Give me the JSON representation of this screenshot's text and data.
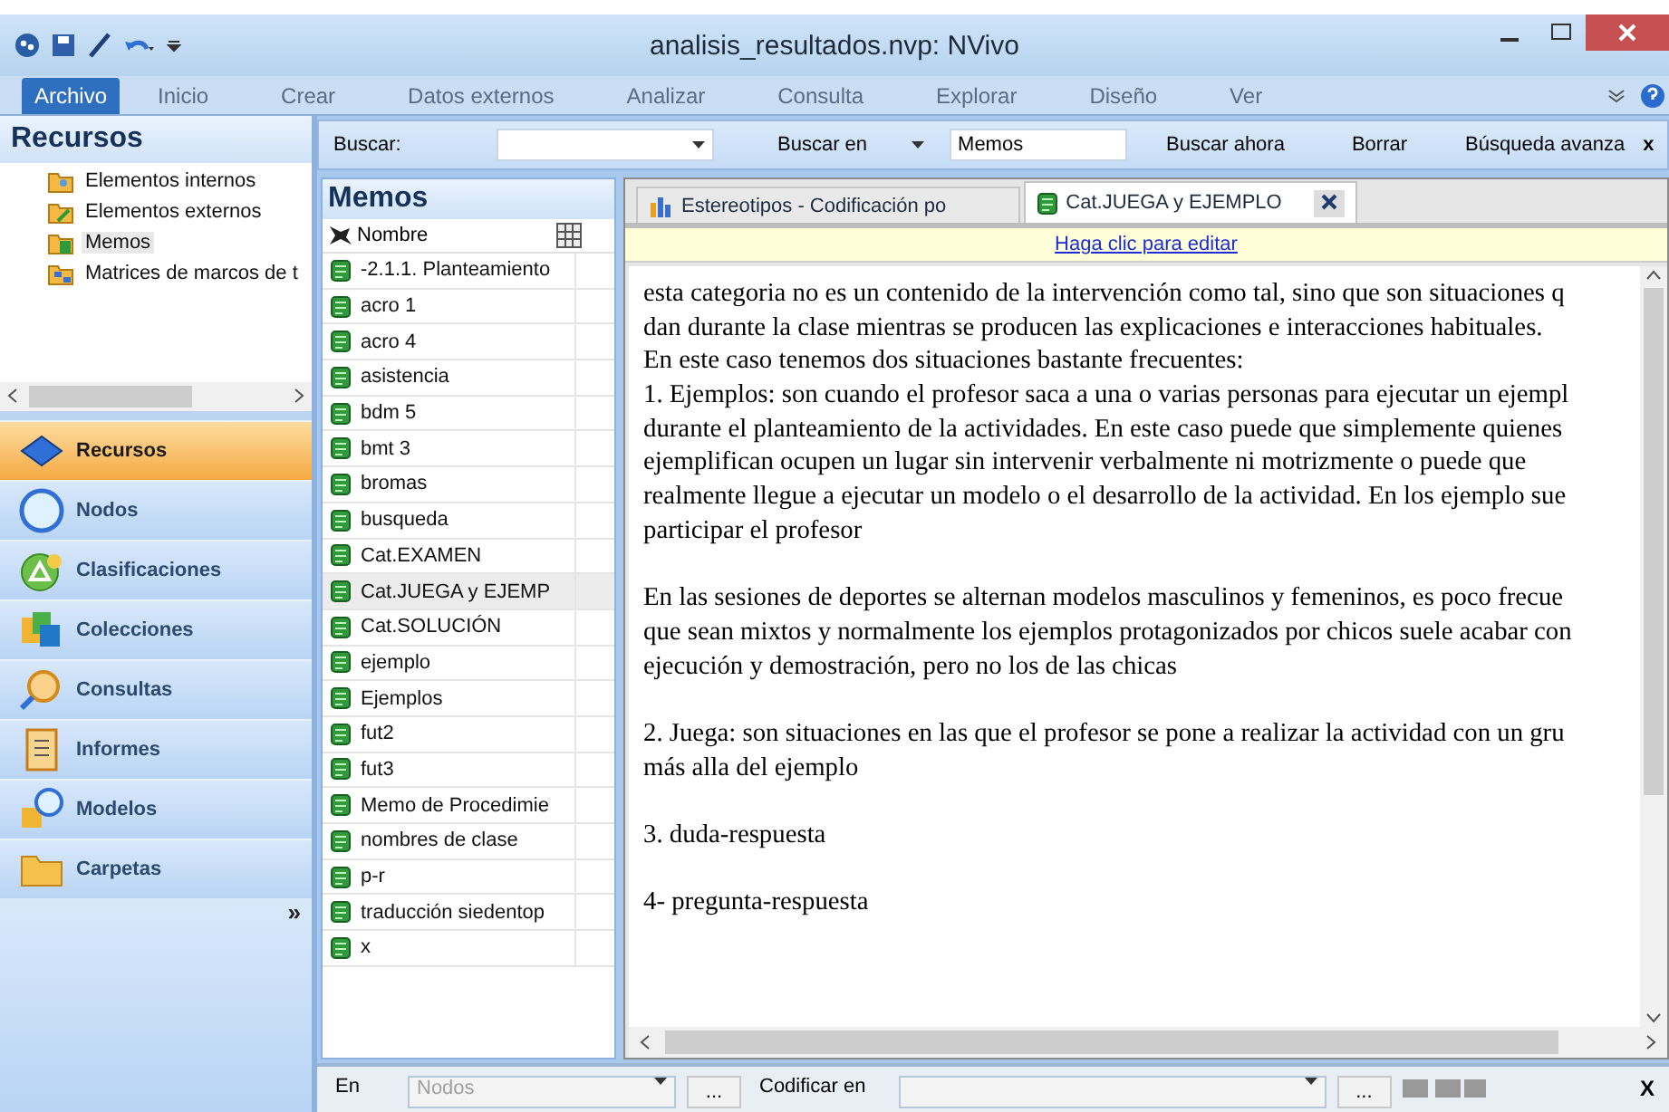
{
  "window": {
    "title": "analisis_resultados.nvp: NVivo"
  },
  "ribbon_tabs": [
    {
      "label": "Archivo",
      "selected": true
    },
    {
      "label": "Inicio",
      "selected": false
    },
    {
      "label": "Crear",
      "selected": false
    },
    {
      "label": "Datos externos",
      "selected": false
    },
    {
      "label": "Analizar",
      "selected": false
    },
    {
      "label": "Consulta",
      "selected": false
    },
    {
      "label": "Explorar",
      "selected": false
    },
    {
      "label": "Diseño",
      "selected": false
    },
    {
      "label": "Ver",
      "selected": false
    }
  ],
  "search_bar": {
    "label": "Buscar:",
    "search_in_label": "Buscar en",
    "search_in_value": "Memos",
    "buttons": [
      "Buscar ahora",
      "Borrar",
      "Búsqueda avanza"
    ],
    "close": "x"
  },
  "navigation": {
    "title": "Recursos",
    "items": [
      {
        "label": "Elementos internos",
        "kind": "internal",
        "selected": false
      },
      {
        "label": "Elementos externos",
        "kind": "external",
        "selected": false
      },
      {
        "label": "Memos",
        "kind": "memos",
        "selected": true
      },
      {
        "label": "Matrices de marcos de t",
        "kind": "matrix",
        "selected": false
      }
    ],
    "sections": [
      {
        "label": "Recursos",
        "kind": "resources",
        "selected": true
      },
      {
        "label": "Nodos",
        "kind": "nodes",
        "selected": false
      },
      {
        "label": "Clasificaciones",
        "kind": "classifications",
        "selected": false
      },
      {
        "label": "Colecciones",
        "kind": "collections",
        "selected": false
      },
      {
        "label": "Consultas",
        "kind": "queries",
        "selected": false
      },
      {
        "label": "Informes",
        "kind": "reports",
        "selected": false
      },
      {
        "label": "Modelos",
        "kind": "models",
        "selected": false
      },
      {
        "label": "Carpetas",
        "kind": "folders",
        "selected": false
      }
    ],
    "overflow_glyph": "»"
  },
  "memos": {
    "title": "Memos",
    "column": "Nombre",
    "rows": [
      {
        "name": "-2.1.1. Planteamiento",
        "selected": false
      },
      {
        "name": "acro 1",
        "selected": false
      },
      {
        "name": "acro 4",
        "selected": false
      },
      {
        "name": "asistencia",
        "selected": false
      },
      {
        "name": "bdm 5",
        "selected": false
      },
      {
        "name": "bmt 3",
        "selected": false
      },
      {
        "name": "bromas",
        "selected": false
      },
      {
        "name": "busqueda",
        "selected": false
      },
      {
        "name": "Cat.EXAMEN",
        "selected": false
      },
      {
        "name": "Cat.JUEGA y EJEMP",
        "selected": true
      },
      {
        "name": "Cat.SOLUCIÓN",
        "selected": false
      },
      {
        "name": "ejemplo",
        "selected": false
      },
      {
        "name": "Ejemplos",
        "selected": false
      },
      {
        "name": "fut2",
        "selected": false
      },
      {
        "name": "fut3",
        "selected": false
      },
      {
        "name": "Memo de Procedimie",
        "selected": false
      },
      {
        "name": "nombres de clase",
        "selected": false
      },
      {
        "name": "p-r",
        "selected": false
      },
      {
        "name": "traducción siedentop",
        "selected": false
      },
      {
        "name": "x",
        "selected": false
      }
    ]
  },
  "document": {
    "tabs": [
      {
        "label": "Estereotipos - Codificación po",
        "kind": "chart",
        "selected": false
      },
      {
        "label": "Cat.JUEGA y EJEMPLO",
        "kind": "memo",
        "selected": true
      }
    ],
    "edit_link": "Haga clic para editar",
    "paragraphs": [
      [
        "esta categoria no es un contenido de la intervención como tal, sino que son situaciones q",
        "dan durante la clase mientras se producen las explicaciones e interacciones habituales.",
        "En este caso tenemos dos situaciones bastante frecuentes:",
        "1. Ejemplos: son cuando el profesor saca a una o varias personas para ejecutar un ejempl",
        "durante el planteamiento de la actividades. En este caso puede que simplemente quienes",
        "ejemplifican ocupen un lugar sin intervenir verbalmente ni motrizmente o puede que",
        "realmente llegue a ejecutar un modelo o el desarrollo de la actividad. En los ejemplo sue",
        "participar el profesor"
      ],
      [
        "En las sesiones de deportes se alternan modelos masculinos y femeninos, es poco frecue",
        "que sean mixtos y normalmente los ejemplos protagonizados por chicos suele acabar con",
        "ejecución y demostración, pero no los de las chicas"
      ],
      [
        "2. Juega: son situaciones en las que el profesor se pone a realizar la actividad con un gru",
        "más alla del ejemplo"
      ],
      [
        "3. duda-respuesta"
      ],
      [
        "4- pregunta-respuesta"
      ]
    ]
  },
  "coding_bar": {
    "in_label": "En",
    "in_placeholder": "Nodos",
    "code_label": "Codificar en",
    "browse": "...",
    "close": "X"
  }
}
